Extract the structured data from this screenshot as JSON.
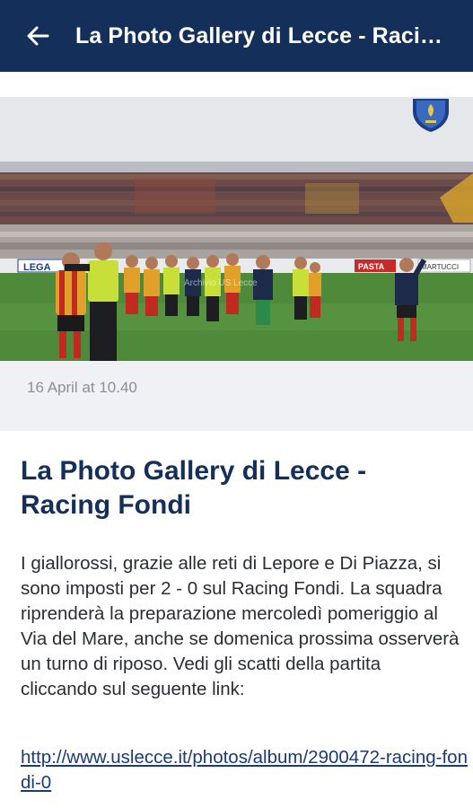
{
  "appbar": {
    "title": "La Photo Gallery di Lecce - Racing Fondi",
    "back_icon": "arrow-left-icon"
  },
  "photo": {
    "watermark": "Archivio US Lecce",
    "boards": [
      "LEGA",
      "PASTA",
      "MARTUCCI"
    ],
    "crest_icon": "club-crest-icon"
  },
  "meta": {
    "date": "16 April at 10.40"
  },
  "article": {
    "title": "La Photo Gallery di Lecce - Racing Fondi",
    "body": "I giallorossi, grazie alle reti di Lepore e Di Piazza, si sono imposti per 2 - 0 sul Racing Fondi. La squadra riprenderà la preparazione mercoledì pomeriggio al Via del Mare, anche se domenica prossima osserverà un turno di riposo. Vedi gli scatti della partita cliccando sul seguente link:",
    "link": "http://www.uslecce.it/photos/album/2900472-racing-fondi-0"
  }
}
